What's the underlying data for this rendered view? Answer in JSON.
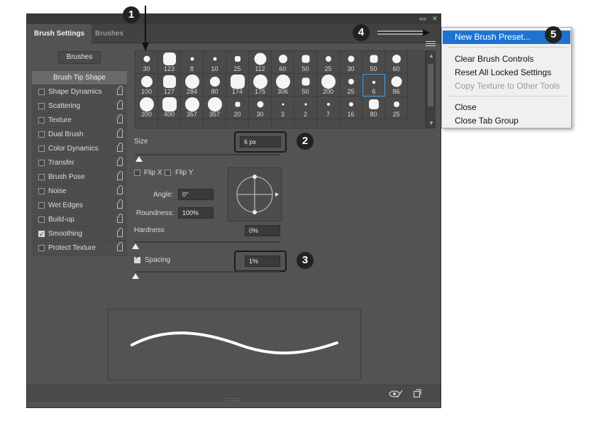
{
  "window": {
    "collapse_icon": "double-chevron-icon",
    "collapse_glyph": "««",
    "close_glyph": "✕"
  },
  "tabs": [
    {
      "label": "Brush Settings",
      "active": true
    },
    {
      "label": "Brushes",
      "active": false
    }
  ],
  "brushes_button": "Brushes",
  "sidebar": {
    "header": "Brush Tip Shape",
    "items": [
      {
        "label": "Shape Dynamics",
        "checked": false
      },
      {
        "label": "Scattering",
        "checked": false
      },
      {
        "label": "Texture",
        "checked": false
      },
      {
        "label": "Dual Brush",
        "checked": false
      },
      {
        "label": "Color Dynamics",
        "checked": false
      },
      {
        "label": "Transfer",
        "checked": false
      },
      {
        "label": "Brush Pose",
        "checked": false
      },
      {
        "label": "Noise",
        "checked": false
      },
      {
        "label": "Wet Edges",
        "checked": false
      },
      {
        "label": "Build-up",
        "checked": false
      },
      {
        "label": "Smoothing",
        "checked": true
      },
      {
        "label": "Protect Texture",
        "checked": false
      }
    ]
  },
  "brush_presets": [
    "30",
    "123",
    "8",
    "10",
    "25",
    "112",
    "60",
    "50",
    "25",
    "30",
    "50",
    "60",
    "100",
    "127",
    "284",
    "80",
    "174",
    "175",
    "306",
    "50",
    "200",
    "25",
    "6",
    "86",
    "200",
    "400",
    "357",
    "357",
    "20",
    "30",
    "3",
    "2",
    "7",
    "16",
    "80",
    "25"
  ],
  "selected_preset_index": 22,
  "controls": {
    "size_label": "Size",
    "size_value": "6 px",
    "flip_x": "Flip X",
    "flip_y": "Flip Y",
    "angle_label": "Angle:",
    "angle_value": "0°",
    "roundness_label": "Roundness:",
    "roundness_value": "100%",
    "hardness_label": "Hardness",
    "hardness_value": "0%",
    "spacing_label": "Spacing",
    "spacing_value": "1%",
    "spacing_checked": true
  },
  "menu": {
    "items": [
      {
        "label": "New Brush Preset...",
        "state": "highlighted"
      },
      {
        "label": "Clear Brush Controls",
        "state": "normal"
      },
      {
        "label": "Reset All Locked Settings",
        "state": "normal"
      },
      {
        "label": "Copy Texture to Other Tools",
        "state": "disabled"
      },
      {
        "label": "Close",
        "state": "normal"
      },
      {
        "label": "Close Tab Group",
        "state": "normal"
      }
    ]
  },
  "callouts": [
    "1",
    "2",
    "3",
    "4",
    "5"
  ],
  "colors": {
    "panel": "#535353",
    "highlight": "#1e73d0",
    "selection": "#4aa3e0"
  }
}
